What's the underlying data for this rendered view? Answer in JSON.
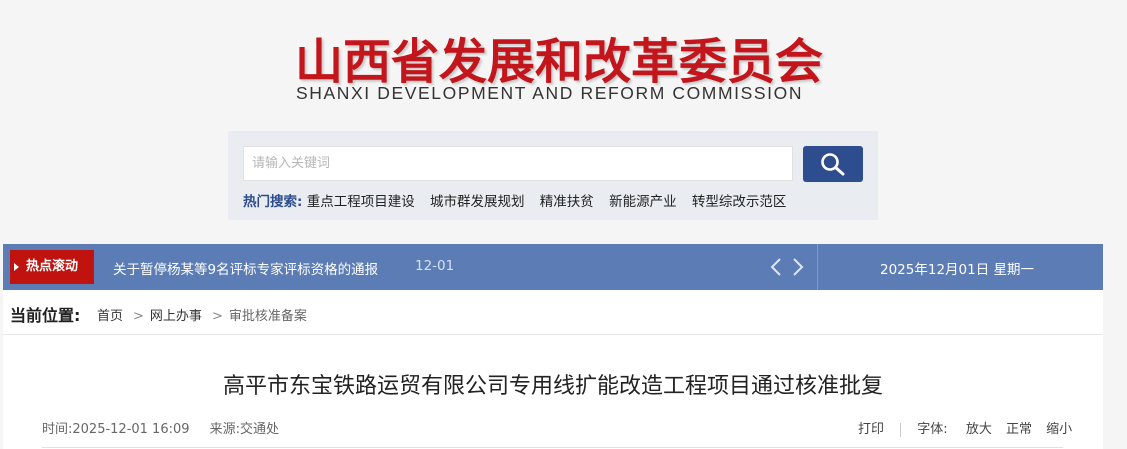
{
  "header": {
    "title_cn": "山西省发展和改革委员会",
    "title_en": "SHANXI DEVELOPMENT AND REFORM COMMISSION"
  },
  "search": {
    "placeholder": "请输入关键词",
    "hot_label": "热门搜索:",
    "hot_terms": [
      "重点工程项目建设",
      "城市群发展规划",
      "精准扶贫",
      "新能源产业",
      "转型综改示范区"
    ]
  },
  "ticker": {
    "badge": "热点滚动",
    "headline": "关于暂停杨某等9名评标专家评标资格的通报",
    "headline_date": "12-01",
    "today": "2025年12月01日  星期一"
  },
  "breadcrumb": {
    "label": "当前位置:",
    "items": [
      "首页",
      "网上办事",
      "审批核准备案"
    ]
  },
  "article": {
    "title": "高平市东宝铁路运贸有限公司专用线扩能改造工程项目通过核准批复",
    "time": "时间:2025-12-01 16:09",
    "source": "来源:交通处",
    "print": "打印",
    "font_label": "字体:",
    "font_large": "放大",
    "font_normal": "正常",
    "font_small": "缩小"
  },
  "colors": {
    "brand_red": "#c3161c",
    "nav_blue": "#5b7cb5",
    "button_blue": "#2e4d8f"
  }
}
